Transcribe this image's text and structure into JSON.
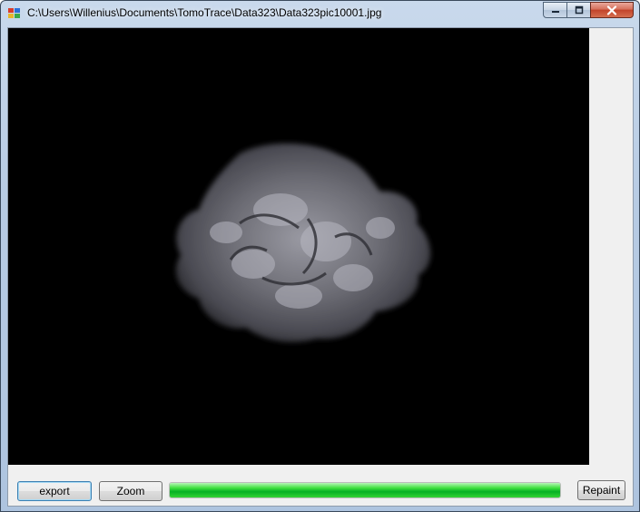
{
  "window": {
    "title": "C:\\Users\\Willenius\\Documents\\TomoTrace\\Data323\\Data323pic10001.jpg",
    "controls": [
      "minimize-icon",
      "maximize-icon",
      "close-icon"
    ]
  },
  "picture": {
    "background": "#000000"
  },
  "toolbar": {
    "export_label": "export",
    "zoom_label": "Zoom",
    "repaint_label": "Repaint"
  },
  "progress": {
    "value": 1.0
  },
  "colors": {
    "progress_green": "#06b025",
    "accent_blue": "#3c7fb1"
  }
}
